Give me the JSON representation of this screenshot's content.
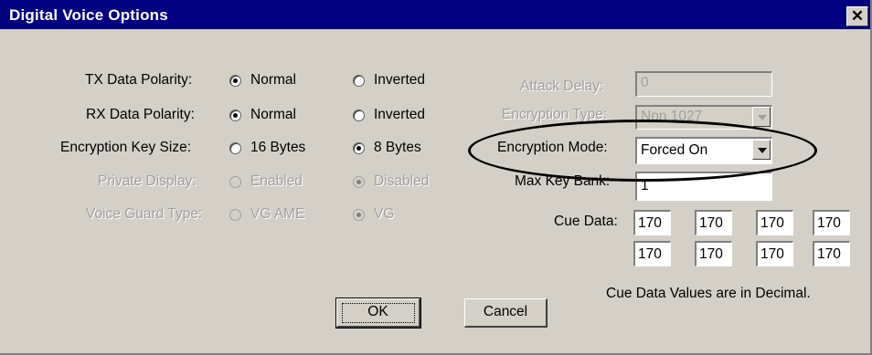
{
  "window": {
    "title": "Digital Voice Options",
    "close_glyph": "✕"
  },
  "left": {
    "tx": {
      "label": "TX Data Polarity:",
      "opt1": "Normal",
      "opt2": "Inverted",
      "selected": "Normal"
    },
    "rx": {
      "label": "RX Data Polarity:",
      "opt1": "Normal",
      "opt2": "Inverted",
      "selected": "Normal"
    },
    "keysize": {
      "label": "Encryption Key Size:",
      "opt1": "16 Bytes",
      "opt2": "8 Bytes",
      "selected": "8 Bytes"
    },
    "private": {
      "label": "Private Display:",
      "opt1": "Enabled",
      "opt2": "Disabled",
      "selected": "Disabled"
    },
    "voiceguard": {
      "label": "Voice Guard Type:",
      "opt1": "VG AME",
      "opt2": "VG",
      "selected": "VG"
    }
  },
  "right": {
    "attack_delay": {
      "label": "Attack Delay:",
      "value": "0"
    },
    "encryption_type": {
      "label": "Encryption Type:",
      "value": "Non 1027"
    },
    "encryption_mode": {
      "label": "Encryption Mode:",
      "value": "Forced On"
    },
    "max_key_bank": {
      "label": "Max Key Bank:",
      "value": "1"
    },
    "cue_data": {
      "label": "Cue Data:",
      "values": [
        "170",
        "170",
        "170",
        "170",
        "170",
        "170",
        "170",
        "170"
      ]
    },
    "note": "Cue Data Values are in Decimal."
  },
  "buttons": {
    "ok": "OK",
    "cancel": "Cancel"
  },
  "colors": {
    "titlebar": "#000080",
    "face": "#d4d0c8",
    "disabled_text": "#a0a0a0"
  },
  "icons": {
    "close": "close-icon",
    "dropdown": "chevron-down-icon",
    "annotation": "hand-drawn-ellipse"
  }
}
